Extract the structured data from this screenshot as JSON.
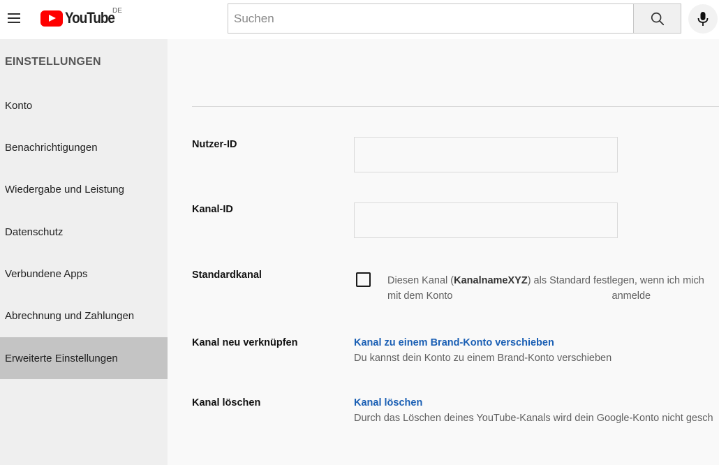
{
  "header": {
    "logo_text": "YouTube",
    "region_code": "DE",
    "search_placeholder": "Suchen"
  },
  "icons": {
    "menu": "hamburger-icon",
    "search": "search-icon",
    "mic": "microphone-icon"
  },
  "sidebar": {
    "heading": "EINSTELLUNGEN",
    "items": [
      {
        "label": "Konto"
      },
      {
        "label": "Benachrichtigungen"
      },
      {
        "label": "Wiedergabe und Leistung"
      },
      {
        "label": "Datenschutz"
      },
      {
        "label": "Verbundene Apps"
      },
      {
        "label": "Abrechnung und Zahlungen"
      },
      {
        "label": "Erweiterte Einstellungen",
        "active": true
      }
    ]
  },
  "main": {
    "user_id": {
      "label": "Nutzer-ID",
      "value": ""
    },
    "channel_id": {
      "label": "Kanal-ID",
      "value": ""
    },
    "default_channel": {
      "label": "Standardkanal",
      "text_before": "Diesen Kanal (",
      "channel_name": "KanalnameXYZ",
      "text_after": ") als Standard festlegen, wenn ich mich",
      "line2_start": "mit dem Konto",
      "line2_end": "anmelde",
      "checked": false
    },
    "relink": {
      "label": "Kanal neu verknüpfen",
      "link": "Kanal zu einem Brand-Konto verschieben",
      "description": "Du kannst dein Konto zu einem Brand-Konto verschieben"
    },
    "delete": {
      "label": "Kanal löschen",
      "link": "Kanal löschen",
      "description": "Durch das Löschen deines YouTube-Kanals wird dein Google-Konto nicht gesch"
    }
  },
  "colors": {
    "brand_red": "#ff0000",
    "link_blue": "#1a5fb4",
    "sidebar_active": "#c4c4c4"
  }
}
